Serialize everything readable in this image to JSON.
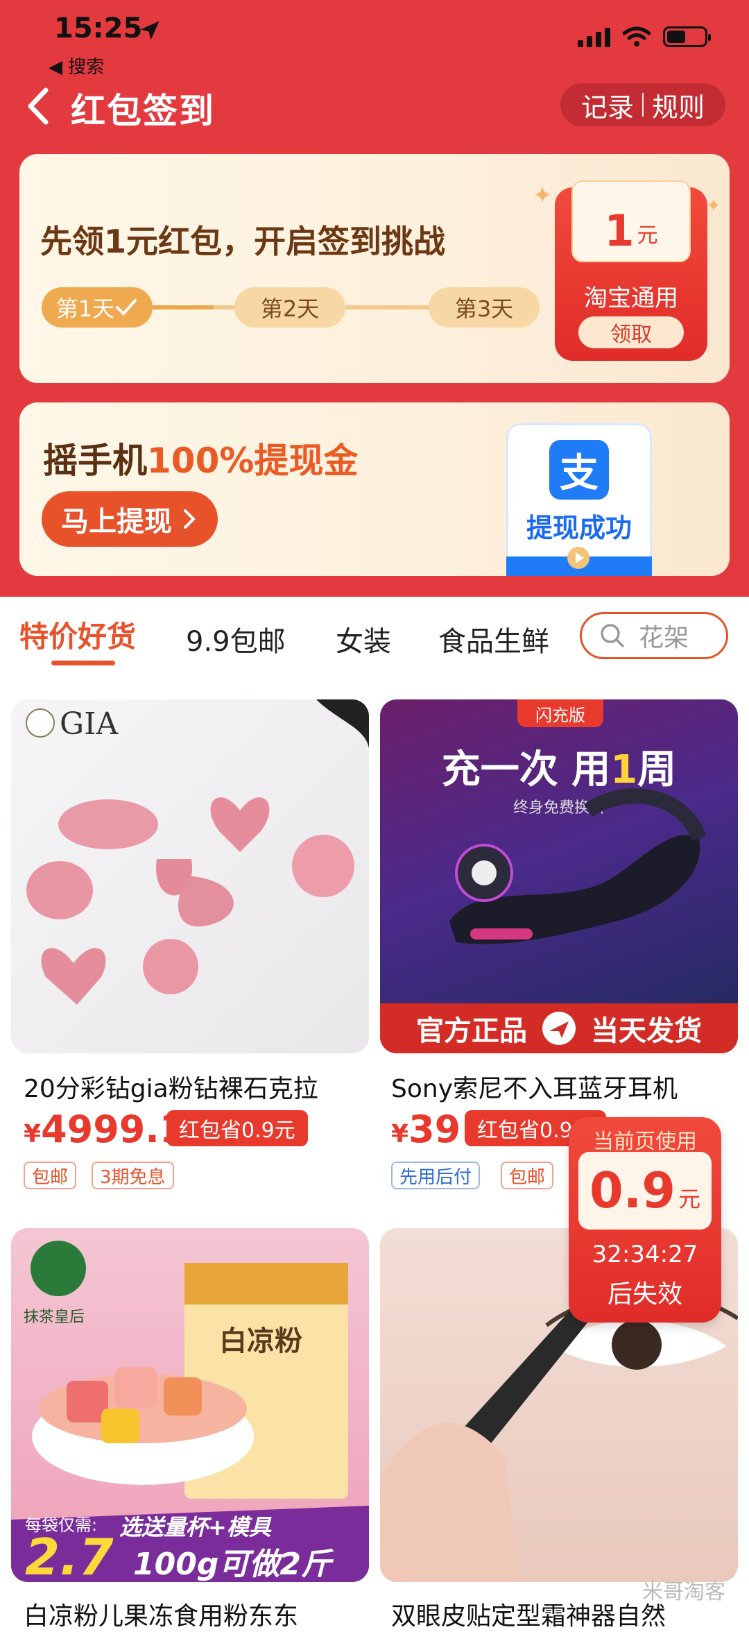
{
  "status_bar": {
    "time": "15:25",
    "back_label": "◀ 搜索"
  },
  "header": {
    "title": "红包签到",
    "records_label": "记录",
    "rules_label": "规则"
  },
  "checkin_card": {
    "title": "先领1元红包，开启签到挑战",
    "days": [
      "第1天",
      "第2天",
      "第3天"
    ],
    "reward": {
      "amount": "1",
      "unit": "元",
      "label": "淘宝通用",
      "claim_label": "领取"
    }
  },
  "shake_card": {
    "title_prefix": "摇手机",
    "title_highlight": "100%提现金",
    "button_label": "马上提现",
    "alipay_logo_text": "支",
    "alipay_status": "提现成功"
  },
  "tabs": {
    "items": [
      "特价好货",
      "9.9包邮",
      "女装",
      "食品生鲜"
    ],
    "search_placeholder": "花架"
  },
  "products": [
    {
      "title": "20分彩钻gia粉钻裸石克拉",
      "currency": "¥",
      "price": "4999.1",
      "coupon": "红包省0.9元",
      "tags": [
        "包邮",
        "3期免息"
      ],
      "image_text": "GIA"
    },
    {
      "title": "Sony索尼不入耳蓝牙耳机",
      "currency": "¥",
      "price": "39",
      "coupon": "红包省0.9元",
      "tags": [
        "先用后付",
        "包邮"
      ],
      "image_badge": "闪充版",
      "image_headline_a": "充一次 用",
      "image_headline_b": "1",
      "image_headline_c": "周",
      "image_sub": "终身免费换新",
      "image_footer_left": "官方正品",
      "image_footer_right": "当天发货"
    },
    {
      "title": "白凉粉儿果冻食用粉东东",
      "image_brand": "抹茶皇后",
      "image_pack": "白凉粉",
      "image_price_label": "每袋仅需:",
      "image_price": "2.7",
      "image_promo": "选送量杯+模具",
      "image_yield": "100g可做2斤"
    },
    {
      "title": "双眼皮贴定型霜神器自然"
    }
  ],
  "floating_coupon": {
    "header": "当前页使用",
    "amount": "0.9",
    "unit": "元",
    "countdown": "32:34:27",
    "expire_label": "后失效"
  },
  "watermark": "米哥淘客",
  "colors": {
    "brand_red": "#e23a3f",
    "accent_orange": "#e8522b",
    "price_red": "#e8392d",
    "alipay_blue": "#1f7bf6"
  }
}
